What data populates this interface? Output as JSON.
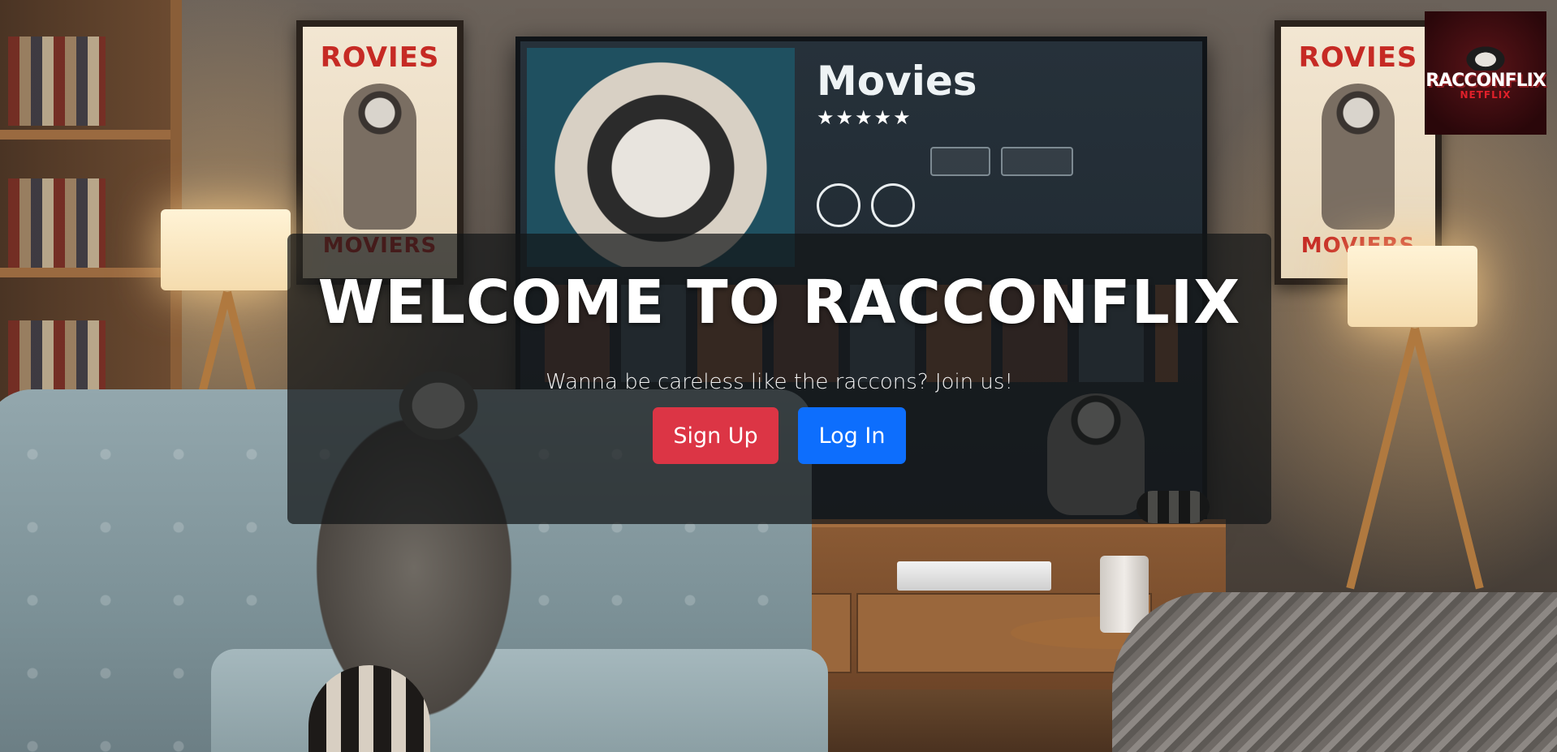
{
  "page": {
    "background": "raccoon-living-room-illustration"
  },
  "logo": {
    "name": "RACCONFLIX",
    "subtitle": "NETFLIX",
    "icon": "raccoon-mascot-icon",
    "colors": {
      "background": "#4a0f13",
      "accent": "#e0202a",
      "text": "#ffffff"
    }
  },
  "scene": {
    "poster_title": "ROVIES",
    "poster_subtitle": "MOVIERS",
    "tv_title": "Movies",
    "tv_stars": "★★★★★"
  },
  "hero": {
    "title": "WELCOME TO RACCONFLIX",
    "subtitle": "Wanna be careless like the raccons? Join us!",
    "signup_label": "Sign Up",
    "login_label": "Log In",
    "colors": {
      "signup": "#dc3545",
      "login": "#0d6efd",
      "panel": "rgba(20,22,24,0.72)"
    }
  }
}
